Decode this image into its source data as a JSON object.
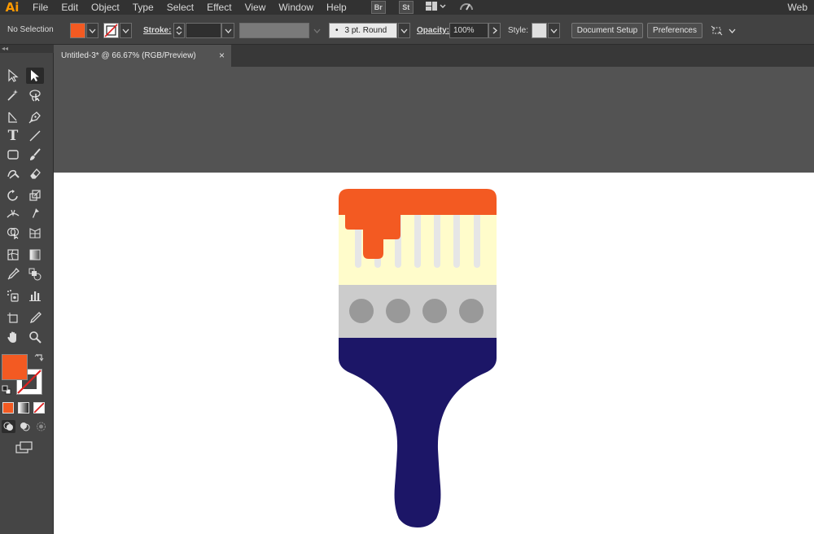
{
  "app": {
    "logo": "Ai"
  },
  "menu": [
    "File",
    "Edit",
    "Object",
    "Type",
    "Select",
    "Effect",
    "View",
    "Window",
    "Help"
  ],
  "bridge": {
    "br": "Br",
    "st": "St"
  },
  "workspace": {
    "label": "Web"
  },
  "control_bar": {
    "selection": "No Selection",
    "stroke_label": "Stroke:",
    "brush_label": "3 pt. Round",
    "brush_dot": "•",
    "opacity_label": "Opacity:",
    "opacity_value": "100%",
    "style_label": "Style:",
    "document_setup": "Document Setup",
    "preferences": "Preferences"
  },
  "document": {
    "tab_title": "Untitled-3* @ 66.67% (RGB/Preview)",
    "close": "×"
  },
  "colors": {
    "fill": "#f35a22",
    "paint_orange": "#f35a22",
    "bristle_cream": "#fffccb",
    "bristle_line": "#e6e6e6",
    "ferrule_gray": "#cccccc",
    "rivet_gray": "#999999",
    "handle_navy": "#1c1667",
    "artboard": "#ffffff",
    "pasteboard": "#535353"
  },
  "icons": {
    "selection": "selection-arrow-icon",
    "direct_selection": "direct-selection-icon",
    "magic_wand": "magic-wand-icon",
    "lasso": "lasso-icon",
    "pen": "pen-icon",
    "type": "type-icon",
    "line": "line-segment-icon",
    "rectangle": "rectangle-icon",
    "paintbrush": "paintbrush-icon",
    "eraser": "eraser-icon",
    "rotate": "rotate-icon",
    "scale": "scale-icon",
    "eyedropper": "eyedropper-icon",
    "hand": "hand-icon",
    "zoom": "zoom-icon"
  },
  "tools": {
    "type_glyph": "T"
  }
}
